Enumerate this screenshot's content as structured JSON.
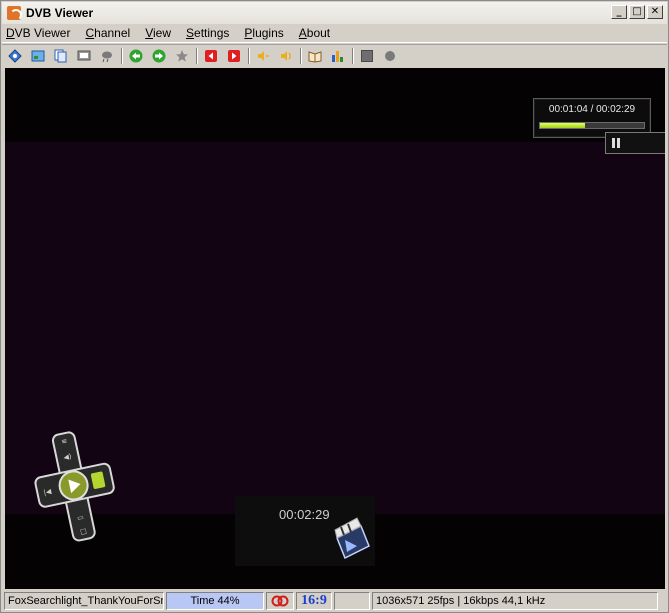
{
  "window": {
    "title": "DVB Viewer"
  },
  "menubar": {
    "items": [
      "DVB Viewer",
      "Channel",
      "View",
      "Settings",
      "Plugins",
      "About"
    ]
  },
  "toolbar": {
    "buttons": [
      "channel-list-icon",
      "picture-icon",
      "copy-icon",
      "screen-icon",
      "weather-icon",
      "back-arrow-icon",
      "forward-arrow-icon",
      "favorites-star-icon",
      "previous-red-icon",
      "next-red-icon",
      "volume-down-icon",
      "volume-up-icon",
      "book-icon",
      "equalizer-icon",
      "stop-icon",
      "record-icon"
    ]
  },
  "osd": {
    "position_display": "00:01:04 / 00:02:29",
    "progress": 0.43,
    "duration": "00:02:29"
  },
  "statusbar": {
    "file": "FoxSearchlight_ThankYouForSmo",
    "time": "Time 44%",
    "aspect": "16:9",
    "info": "1036x571 25fps | 16kbps 44,1 kHz"
  },
  "colors": {
    "time_panel_bg": "#b9c7f5",
    "aspect_text": "#1a3fcf",
    "progress_fill": "#c6f03a",
    "video_bg": "#120412"
  }
}
